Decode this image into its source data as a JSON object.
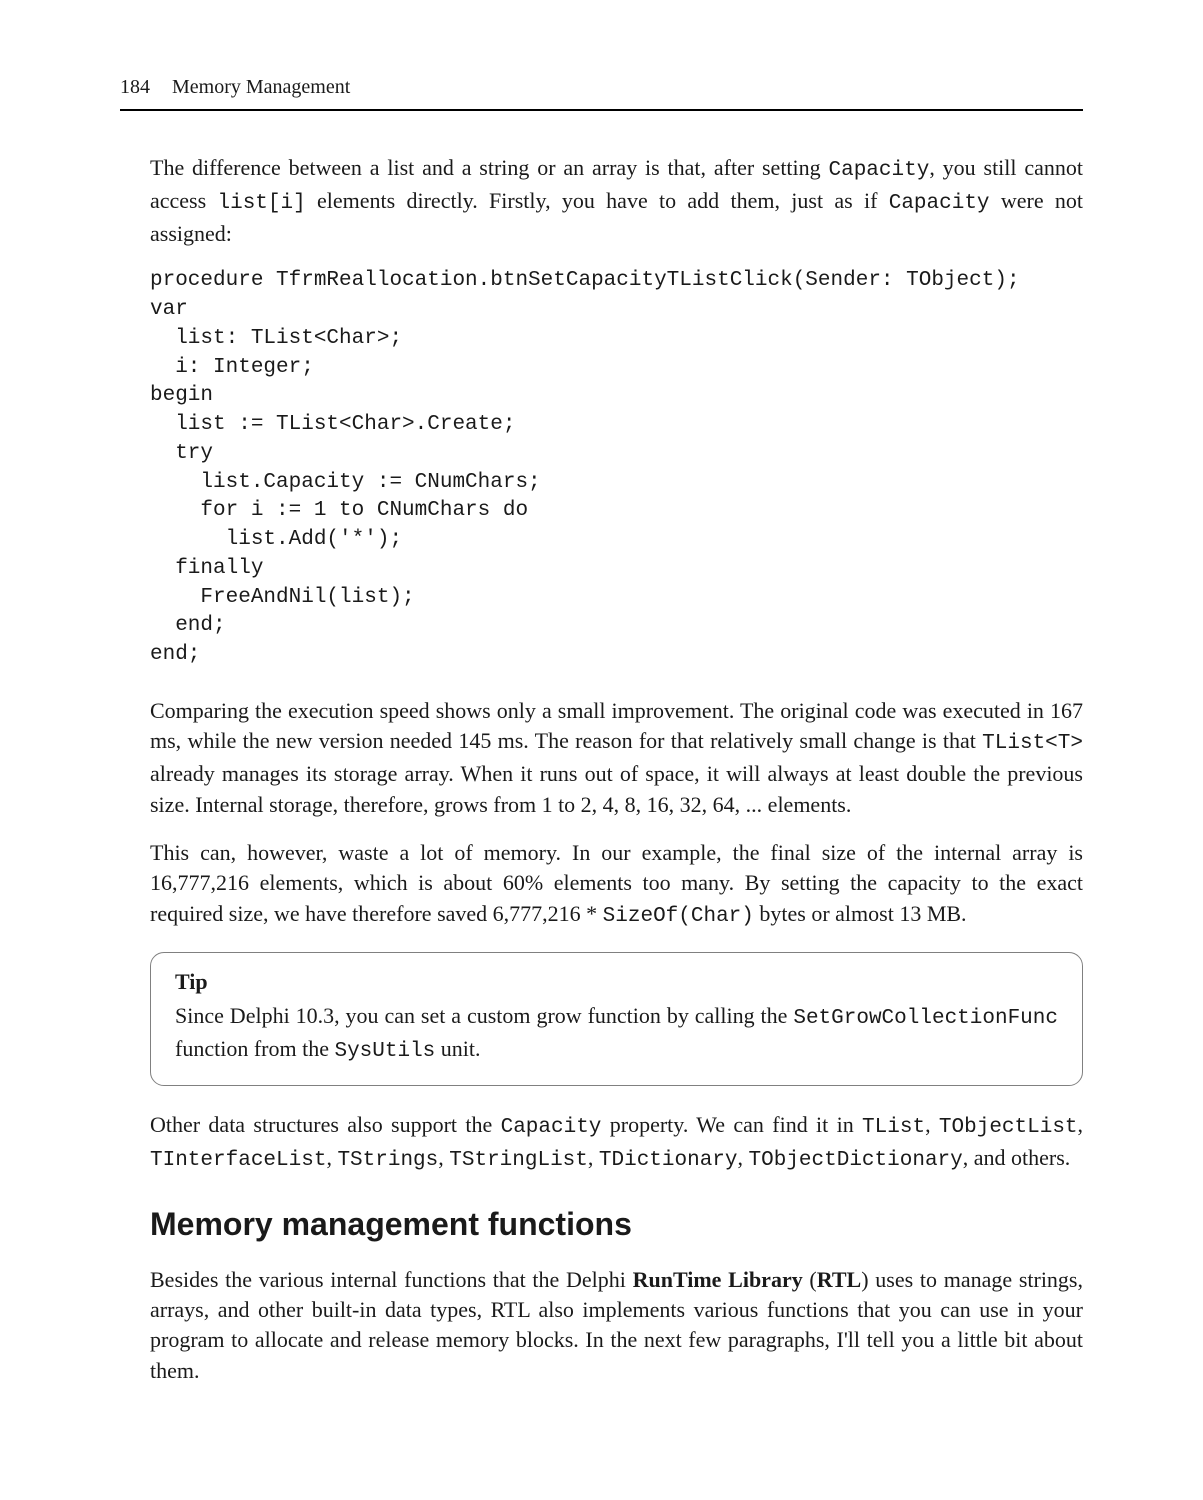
{
  "header": {
    "page_number": "184",
    "chapter_title": "Memory Management"
  },
  "paragraphs": {
    "intro_a": "The difference between a list and a string or an array is that, after setting ",
    "intro_b": ", you still cannot access ",
    "intro_c": " elements directly. Firstly, you have to add them, just as if ",
    "intro_d": " were not assigned:",
    "code_capacity_1": "Capacity",
    "code_listi": "list[i]",
    "code_capacity_2": "Capacity",
    "code_block": "procedure TfrmReallocation.btnSetCapacityTListClick(Sender: TObject);\nvar\n  list: TList<Char>;\n  i: Integer;\nbegin\n  list := TList<Char>.Create;\n  try\n    list.Capacity := CNumChars;\n    for i := 1 to CNumChars do\n      list.Add('*');\n  finally\n    FreeAndNil(list);\n  end;\nend;",
    "compare_a": "Comparing the execution speed shows only a small improvement. The original code was executed in 167 ms, while the new version needed 145 ms. The reason for that relatively small change is that ",
    "compare_b": " already manages its storage array. When it runs out of space, it will always at least double the previous size. Internal storage, therefore, grows from 1 to 2, 4, 8, 16, 32, 64, ... elements.",
    "code_tlist_t": "TList<T>",
    "waste_a": "This can, however, waste a lot of memory. In our example, the final size of the internal array is 16,777,216 elements, which is about 60% elements too many. By setting the capacity to the exact required size, we have therefore saved 6,777,216 * ",
    "waste_b": " bytes or almost 13 MB.",
    "code_sizeof": "SizeOf(Char)",
    "tip_label": "Tip",
    "tip_a": "Since Delphi 10.3, you can set a custom grow function by calling the ",
    "tip_b": " function from the ",
    "tip_c": " unit.",
    "code_setgrow": "SetGrowCollectionFunc",
    "code_sysutils": "SysUtils",
    "other_a": "Other data structures also support the ",
    "other_b": " property. We can find it in ",
    "other_c": ", and others.",
    "code_capacity_3": "Capacity",
    "code_tlist": "TList",
    "code_tobjectlist": "TObjectList",
    "code_tinterfacelist": "TInterfaceList",
    "code_tstrings": "TStrings",
    "code_tstringlist": "TStringList",
    "code_tdictionary": "TDictionary",
    "code_tobjectdictionary": "TObjectDictionary",
    "section_heading": "Memory management functions",
    "mmf_a": "Besides the various internal functions that the Delphi ",
    "mmf_b": "RunTime Library",
    "mmf_c": " (",
    "mmf_d": "RTL",
    "mmf_e": ") uses to manage strings, arrays, and other built-in data types, RTL also implements various functions that you can use in your program to allocate and release memory blocks. In the next few paragraphs, I'll tell you a little bit about them."
  }
}
